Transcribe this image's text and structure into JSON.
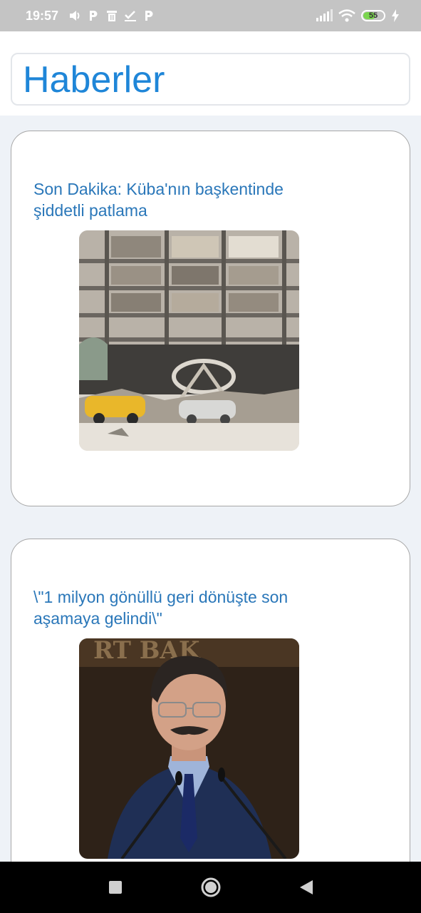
{
  "status_bar": {
    "time": "19:57",
    "battery_level": "55",
    "icons": [
      "volume-icon",
      "parking-icon",
      "trash-icon",
      "check-icon",
      "parking-icon",
      "signal-icon",
      "wifi-icon",
      "battery-icon",
      "charging-icon"
    ]
  },
  "header": {
    "title": "Haberler"
  },
  "news": [
    {
      "headline": "Son Dakika: Küba'nın başkentinde şiddetli patlama"
    },
    {
      "headline": "\\\"1 milyon gönüllü geri dönüşte son aşamaya gelindi\\\""
    }
  ],
  "nav": {
    "icons": [
      "recent-apps-icon",
      "home-icon",
      "back-icon"
    ]
  },
  "colors": {
    "title": "#1f86d8",
    "headline": "#2a77b9",
    "background": "#eef2f7"
  }
}
